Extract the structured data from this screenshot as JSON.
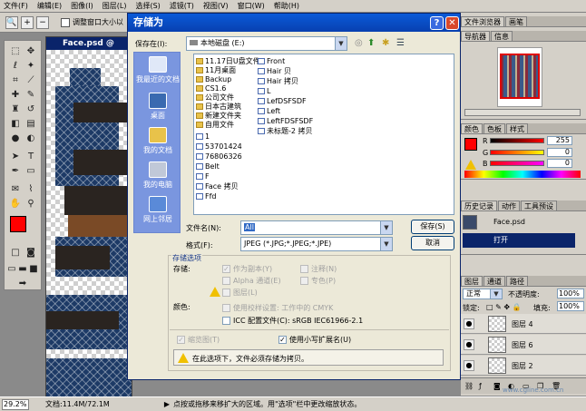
{
  "menubar": {
    "items": [
      "文件(F)",
      "编辑(E)",
      "图像(I)",
      "图层(L)",
      "选择(S)",
      "滤镜(T)",
      "视图(V)",
      "窗口(W)",
      "帮助(H)"
    ]
  },
  "options": {
    "label": "调整窗口大小以"
  },
  "document": {
    "title": "Face.psd @ 29.2%"
  },
  "status": {
    "zoom": "29.2%",
    "docsize": "文档:11.4M/72.1M",
    "hint": "点按或拖移来移扩大的区域。用\"选项\"栏中更改缩放状态。"
  },
  "dialog": {
    "title": "存储为",
    "save_in_label": "保存在(I):",
    "save_in_value": "本地磁盘 (E:)",
    "places": [
      "我最近的文档",
      "桌面",
      "我的文档",
      "我的电脑",
      "网上邻居"
    ],
    "files_col1": [
      "11.17日U盘文件",
      "11月桌面",
      "Backup",
      "CS1.6",
      "公司文件",
      "日本古建筑",
      "新建文件夹",
      "自用文件",
      "1",
      "53701424",
      "76806326",
      "Belt",
      "F",
      "Face 拷贝",
      "Ffd"
    ],
    "files_col2": [
      "Front",
      "Hair 贝",
      "Hair 拷贝",
      "L",
      "LefDSFSDF",
      "Left",
      "LeftFDSFSDF",
      "未标题-2 拷贝"
    ],
    "filename_label": "文件名(N):",
    "filename_value": "All",
    "format_label": "格式(F):",
    "format_value": "JPEG (*.JPG;*.JPEG;*.JPE)",
    "save_button": "保存(S)",
    "cancel_button": "取消",
    "options_title": "存储选项",
    "store_label": "存储:",
    "opt_as_copy": "作为副本(Y)",
    "opt_annotations": "注释(N)",
    "opt_alpha": "Alpha 通道(E)",
    "opt_spot": "专色(P)",
    "opt_layers": "图层(L)",
    "color_label": "颜色:",
    "opt_proof": "使用校样设置: 工作中的 CMYK",
    "opt_icc": "ICC 配置文件(C): sRGB IEC61966-2.1",
    "opt_thumbnail": "缩览图(T)",
    "opt_lowercase": "使用小写扩展名(U)",
    "warning": "在此选项下，文件必须存储为拷贝。"
  },
  "panels": {
    "top_tabs": [
      "文件浏览器",
      "画笔"
    ],
    "nav_tabs": [
      "导航器",
      "信息"
    ],
    "color_tabs": [
      "颜色",
      "色板",
      "样式"
    ],
    "color_r": "255",
    "color_g": "0",
    "color_b": "0",
    "history_tabs": [
      "历史记录",
      "动作",
      "工具预设"
    ],
    "history_file": "Face.psd",
    "history_open": "打开",
    "layer_tabs": [
      "图层",
      "通道",
      "路径"
    ],
    "blend_mode": "正常",
    "opacity_label": "不透明度:",
    "opacity": "100%",
    "lock_label": "锁定:",
    "fill_label": "填充:",
    "fill": "100%",
    "layers": [
      "图层 4",
      "图层 6",
      "图层 2"
    ],
    "watermark": "www.cgline.com.cn"
  },
  "colors": {
    "foreground": "#ff0000",
    "titlebar": "#0a246a",
    "accent_red": "#e00000"
  }
}
